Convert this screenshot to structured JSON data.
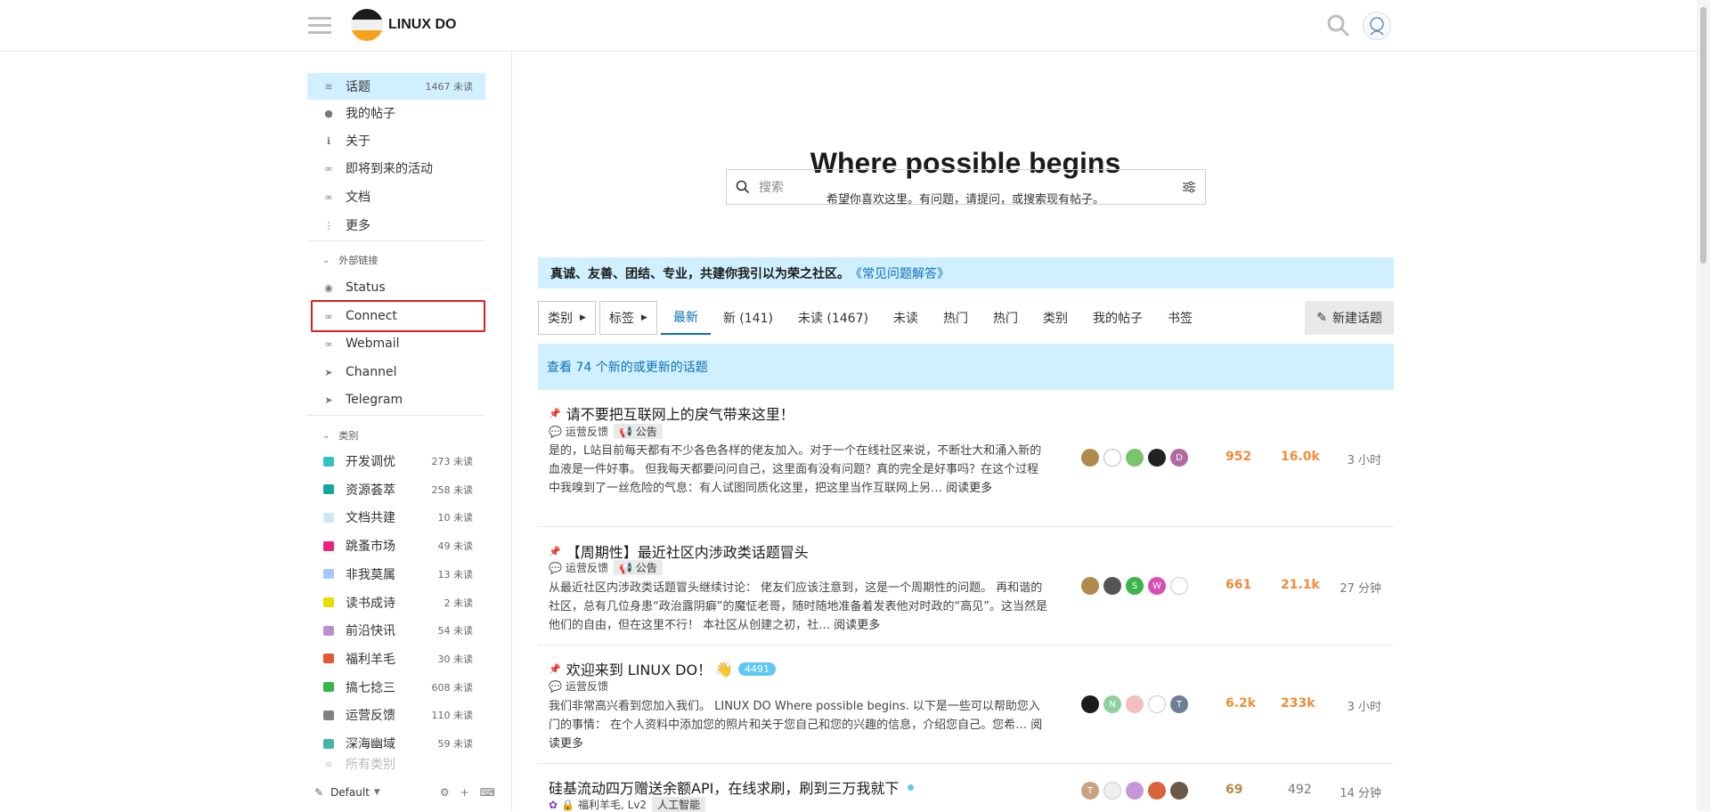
{
  "header": {
    "site_name": "LINUX DO"
  },
  "sidebar": {
    "nav": [
      {
        "label": "话题",
        "count": "1467 未读",
        "icon": "layers-icon"
      },
      {
        "label": "我的帖子",
        "count": "",
        "icon": "user-icon"
      },
      {
        "label": "关于",
        "count": "",
        "icon": "info-icon"
      },
      {
        "label": "即将到来的活动",
        "count": "",
        "icon": "link-icon"
      },
      {
        "label": "文档",
        "count": "",
        "icon": "link-icon"
      },
      {
        "label": "更多",
        "count": "",
        "icon": "more-icon"
      }
    ],
    "external_header": "外部链接",
    "external": [
      {
        "label": "Status",
        "icon": "eye-icon"
      },
      {
        "label": "Connect",
        "icon": "link-icon"
      },
      {
        "label": "Webmail",
        "icon": "link-icon"
      },
      {
        "label": "Channel",
        "icon": "send-icon"
      },
      {
        "label": "Telegram",
        "icon": "send-icon"
      }
    ],
    "categories_header": "类别",
    "categories": [
      {
        "label": "开发调优",
        "count": "273 未读",
        "color": "#32c3c3"
      },
      {
        "label": "资源荟萃",
        "count": "258 未读",
        "color": "#12a89d"
      },
      {
        "label": "文档共建",
        "count": "10 未读",
        "color": "#cfe7f7"
      },
      {
        "label": "跳蚤市场",
        "count": "49 未读",
        "color": "#ed207b"
      },
      {
        "label": "非我莫属",
        "count": "13 未读",
        "color": "#a8c6fe"
      },
      {
        "label": "读书成诗",
        "count": "2 未读",
        "color": "#e9dd00"
      },
      {
        "label": "前沿快讯",
        "count": "54 未读",
        "color": "#bb8fce"
      },
      {
        "label": "福利羊毛",
        "count": "30 未读",
        "color": "#e45735"
      },
      {
        "label": "搞七捻三",
        "count": "608 未读",
        "color": "#3ab54a"
      },
      {
        "label": "运营反馈",
        "count": "110 未读",
        "color": "#808281"
      },
      {
        "label": "深海幽域",
        "count": "59 未读",
        "color": "#45b5aa"
      }
    ],
    "all_categories": "所有类别",
    "theme_label": "Default"
  },
  "main": {
    "hero_title": "Where possible begins",
    "hero_subtitle": "希望你喜欢这里。有问题，请提问，或搜索现有帖子。",
    "search_placeholder": "搜索",
    "banner_text": "真诚、友善、团结、专业，共建你我引以为荣之社区。",
    "banner_link": "《常见问题解答》",
    "filter_categories": "类别",
    "filter_tags": "标签",
    "tabs": [
      "最新",
      "新 (141)",
      "未读 (1467)",
      "未读",
      "热门",
      "热门",
      "类别",
      "我的帖子",
      "书签"
    ],
    "new_topic_label": "新建话题",
    "new_topics_bar": "查看 74 个新的或更新的话题",
    "topics": [
      {
        "title": "请不要把互联网上的戾气带来这里！",
        "category": "运营反馈",
        "tag": "公告",
        "excerpt": "是的，L站目前每天都有不少各色各样的佬友加入。对于一个在线社区来说，不断壮大和涌入新的血液是一件好事。 但我每天都要问问自己，这里面有没有问题？真的完全是好事吗？在这个过程中我嗅到了一丝危险的气息：有人试图同质化这里，把这里当作互联网上另…",
        "read_more": "阅读更多",
        "replies": "952",
        "views": "16.0k",
        "age": "3 小时"
      },
      {
        "title": "【周期性】最近社区内涉政类话题冒头",
        "category": "运营反馈",
        "tag": "公告",
        "excerpt": "从最近社区内涉政类话题冒头继续讨论： 佬友们应该注意到，这是一个周期性的问题。 再和谐的社区，总有几位身患“政治露阴癖”的魔怔老哥，随时随地准备着发表他对时政的“高见”。这当然是他们的自由，但在这里不行！ 本社区从创建之初，社…",
        "read_more": "阅读更多",
        "replies": "661",
        "views": "21.1k",
        "age": "27 分钟"
      },
      {
        "title": "欢迎来到 LINUX DO！",
        "badge": "4491",
        "category": "运营反馈",
        "excerpt": "我们非常高兴看到您加入我们。 LINUX DO Where possible begins. 以下是一些可以帮助您入门的事情： 在个人资料中添加您的照片和关于您自己和您的兴趣的信息，介绍您自己。您希…",
        "read_more": "阅读更多",
        "replies": "6.2k",
        "views": "233k",
        "age": "3 小时"
      },
      {
        "title": "硅基流动四万赠送余额API，在线求刷，刷到三万我就下",
        "category": "福利羊毛, Lv2",
        "tag": "人工智能",
        "replies": "69",
        "views": "492",
        "age": "14 分钟"
      }
    ]
  },
  "colors": {
    "accent": "#0a6fb7",
    "banner_bg": "#d1f0ff",
    "hot": "#f08c3a",
    "highlight_box": "#e41b1b"
  }
}
